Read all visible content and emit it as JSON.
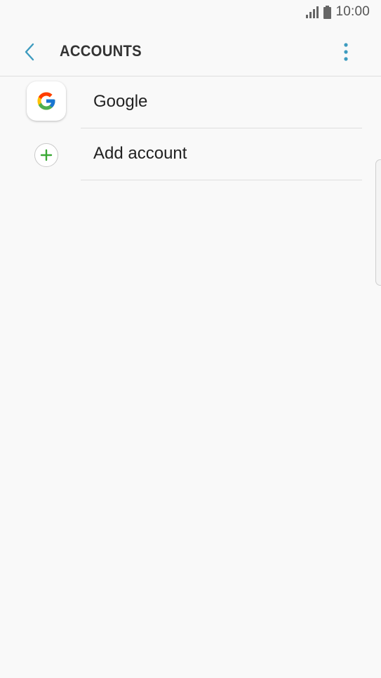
{
  "status_bar": {
    "time": "10:00",
    "signal_icon": "signal-icon",
    "battery_icon": "battery-icon"
  },
  "app_bar": {
    "title": "ACCOUNTS",
    "back_icon": "chevron-left-icon",
    "more_icon": "more-vertical-icon"
  },
  "accounts": {
    "items": [
      {
        "label": "Google",
        "icon": "google-icon"
      },
      {
        "label": "Add account",
        "icon": "plus-icon"
      }
    ]
  },
  "colors": {
    "accent": "#3d9bbf",
    "add_green": "#3aa935",
    "background": "#f9f9f9",
    "divider": "#dedede"
  }
}
